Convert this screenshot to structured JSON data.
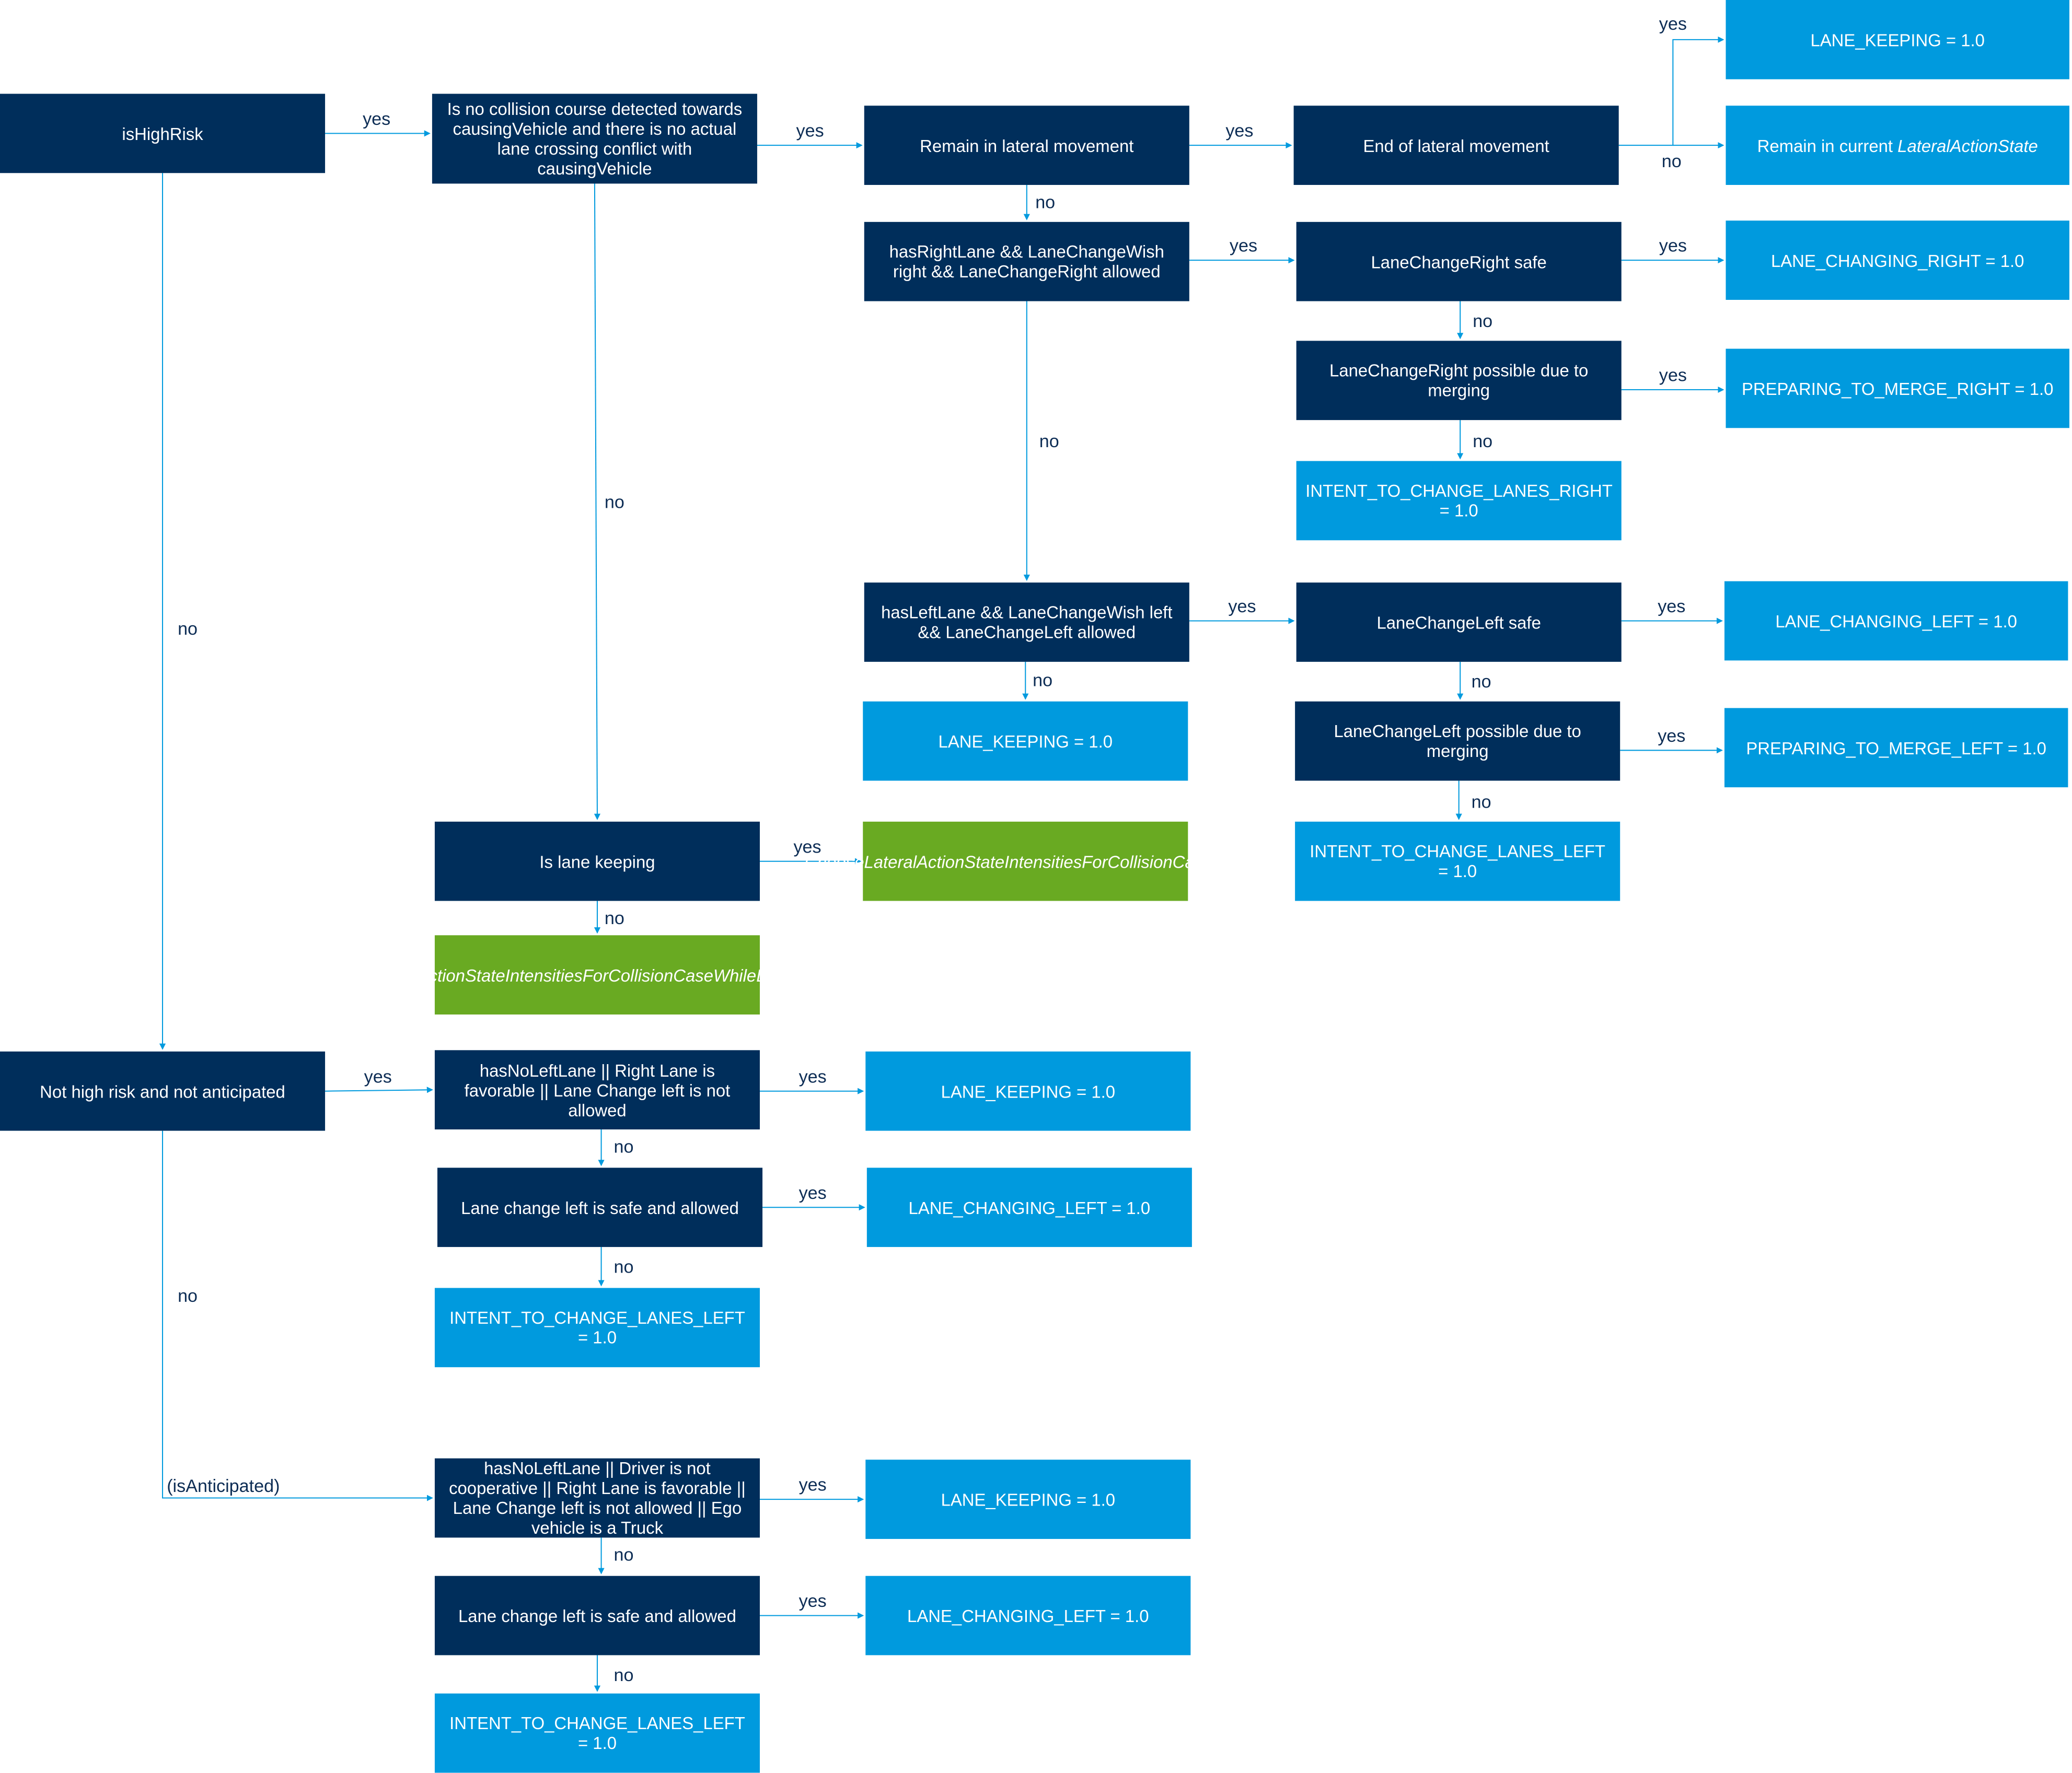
{
  "colors": {
    "decision": "#002e5b",
    "result": "#009ade",
    "action": "#69aa22",
    "connector": "#009ade"
  },
  "nodes": {
    "is_high_risk": "isHighRisk",
    "collision_check": "Is no collision course detected towards causingVehicle and there is no actual lane crossing conflict with causingVehicle",
    "remain_lateral": "Remain in lateral movement",
    "end_lateral": "End of lateral movement",
    "lane_keeping_top": "LANE_KEEPING = 1.0",
    "remain_current_prefix": "Remain in current ",
    "remain_current_italic": "LateralActionState",
    "has_right_lane": "hasRightLane && LaneChangeWish right && LaneChangeRight allowed",
    "lcr_safe": "LaneChangeRight safe",
    "lane_changing_right": "LANE_CHANGING_RIGHT = 1.0",
    "lcr_merging": "LaneChangeRight possible due to merging",
    "prep_merge_right": "PREPARING_TO_MERGE_RIGHT = 1.0",
    "intent_right": "INTENT_TO_CHANGE_LANES_RIGHT = 1.0",
    "has_left_lane": "hasLeftLane && LaneChangeWish left && LaneChangeLeft allowed",
    "lcl_safe": "LaneChangeLeft safe",
    "lane_changing_left_1": "LANE_CHANGING_LEFT = 1.0",
    "lane_keeping_2": "LANE_KEEPING = 1.0",
    "lcl_merging": "LaneChangeLeft possible due to merging",
    "prep_merge_left": "PREPARING_TO_MERGE_LEFT = 1.0",
    "intent_left_1": "INTENT_TO_CHANGE_LANES_LEFT = 1.0",
    "is_lane_keeping": "Is lane keeping",
    "choose_else": "ChooseLateralActionStateIntensitiesForCollisionCaseElse",
    "choose_while": "ChooseLateralActionStateIntensitiesForCollisionCaseWhileLateralMovement",
    "not_high_risk": "Not high risk and not anticipated",
    "no_left_lane_1": "hasNoLeftLane || Right Lane is favorable || Lane Change left is not allowed",
    "lane_keeping_3": "LANE_KEEPING = 1.0",
    "lcl_safe_allowed_1": "Lane change left is safe and allowed",
    "lane_changing_left_2": "LANE_CHANGING_LEFT = 1.0",
    "intent_left_2": "INTENT_TO_CHANGE_LANES_LEFT = 1.0",
    "no_left_lane_2": "hasNoLeftLane || Driver is not cooperative || Right Lane is favorable || Lane Change left is not allowed || Ego vehicle is a Truck",
    "lane_keeping_4": "LANE_KEEPING = 1.0",
    "lcl_safe_allowed_2": "Lane change left is safe and allowed",
    "lane_changing_left_3": "LANE_CHANGING_LEFT = 1.0",
    "intent_left_3": "INTENT_TO_CHANGE_LANES_LEFT = 1.0"
  },
  "edge_labels": {
    "yes": "yes",
    "no": "no",
    "is_anticipated": "(isAnticipated)"
  }
}
